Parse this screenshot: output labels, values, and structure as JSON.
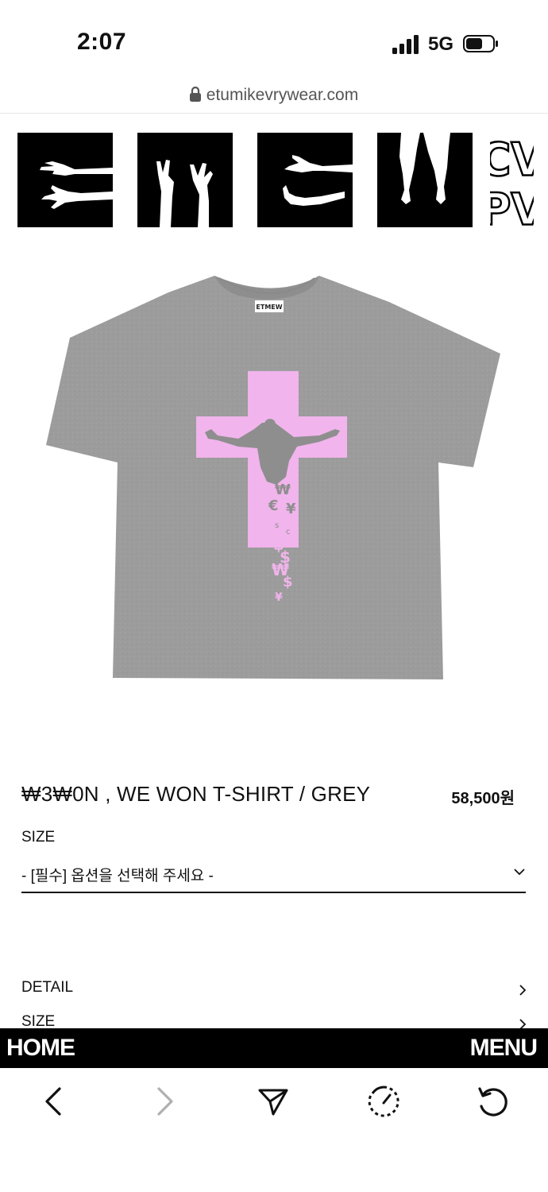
{
  "status_bar": {
    "time": "2:07",
    "network": "5G"
  },
  "browser": {
    "url": "etumikevrywear.com"
  },
  "site_nav": {
    "tiles": [
      "hands-tile",
      "rock-hands-tile",
      "reaching-hands-tile",
      "legs-tile"
    ],
    "logo_line1": "CV",
    "logo_line2": "PV"
  },
  "product": {
    "title": "₩3₩0N , WE WON T-SHIRT / GREY",
    "price": "58,500원",
    "image_icon": "grey-tshirt-pink-cross-graphic",
    "shirt_color": "#9c9c9c",
    "print_color": "#f1b4ec",
    "tag_text": "ETMEW"
  },
  "options": {
    "size_label": "SIZE",
    "size_select_text": "- [필수] 옵션을 선택해 주세요 -"
  },
  "accordion": [
    {
      "label": "DETAIL"
    },
    {
      "label": "SIZE"
    }
  ],
  "site_bar": {
    "home_label": "HOME",
    "menu_label": "MENU"
  },
  "toolbar_icons": [
    "back-icon",
    "forward-icon",
    "share-icon",
    "speed-icon",
    "reload-icon"
  ]
}
